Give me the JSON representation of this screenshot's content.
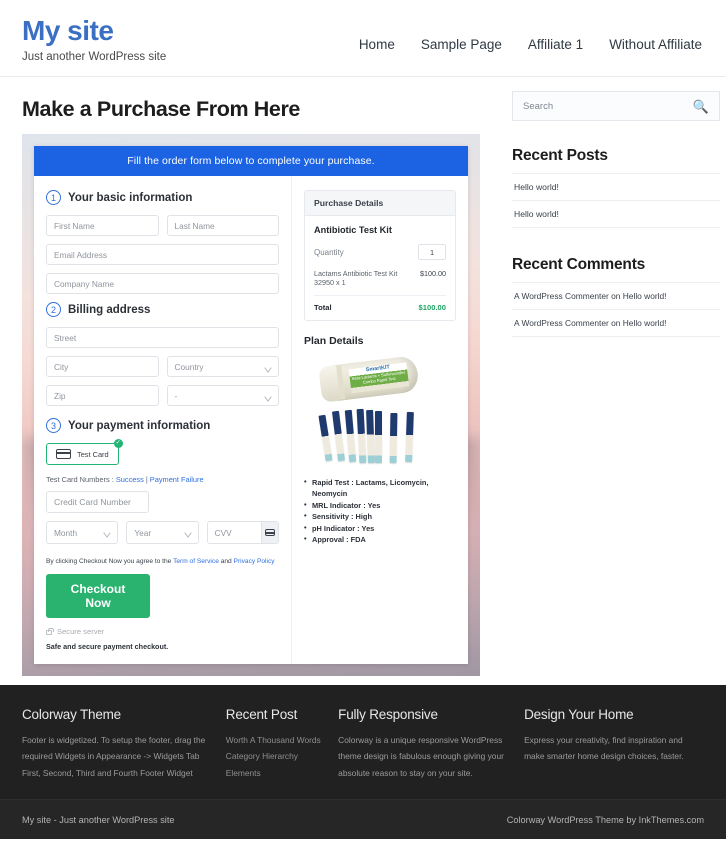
{
  "header": {
    "site_title": "My site",
    "tagline": "Just another WordPress site",
    "nav": [
      {
        "label": "Home"
      },
      {
        "label": "Sample Page"
      },
      {
        "label": "Affiliate 1"
      },
      {
        "label": "Without Affiliate"
      }
    ]
  },
  "main": {
    "page_title": "Make a Purchase From Here",
    "banner": "Fill the order form below to complete your purchase.",
    "steps": {
      "one_num": "1",
      "one_label": "Your basic information",
      "two_num": "2",
      "two_label": "Billing address",
      "three_num": "3",
      "three_label": "Your payment information"
    },
    "fields": {
      "first_name": "First Name",
      "last_name": "Last Name",
      "email": "Email Address",
      "company": "Company Name",
      "street": "Street",
      "city": "City",
      "country": "Country",
      "zip": "Zip",
      "state": "-",
      "credit_card": "Credit Card Number",
      "month": "Month",
      "year": "Year",
      "cvv": "CVV"
    },
    "payment": {
      "method_label": "Test Card",
      "method_tick": "✓",
      "test_cards_prefix": "Test Card Numbers : ",
      "test_card_success": "Success",
      "test_card_sep": " | ",
      "test_card_failure": "Payment Failure",
      "agree_prefix": "By clicking Checkout Now you agree to the ",
      "agree_tos": "Term of Service",
      "agree_and": " and ",
      "agree_privacy": "Privacy Policy",
      "checkout_button": "Checkout Now",
      "secure_server": "Secure server",
      "safe_note": "Safe and secure payment checkout."
    },
    "purchase": {
      "panel_title": "Purchase Details",
      "product_name": "Antibiotic Test Kit",
      "quantity_label": "Quantity",
      "quantity_value": "1",
      "line_item": "Lactams Antibiotic Test Kit 32950 x 1",
      "line_amount": "$100.00",
      "total_label": "Total",
      "total_amount": "$100.00",
      "plan_title": "Plan Details",
      "product_brand": "SmartKIT",
      "product_sub": "Beta-Lactams + Sulfonamides Combo Rapid Test",
      "bullets": [
        "Rapid Test : Lactams, Licomycin, Neomycin",
        "MRL Indicator : Yes",
        "Sensitivity : High",
        "pH Indicator : Yes",
        "Approval : FDA"
      ]
    }
  },
  "sidebar": {
    "search_placeholder": "Search",
    "search_icon": "🔍",
    "recent_posts_title": "Recent Posts",
    "recent_posts": [
      {
        "label": "Hello world!"
      },
      {
        "label": "Hello world!"
      }
    ],
    "recent_comments_title": "Recent Comments",
    "recent_comments": [
      {
        "label": "A WordPress Commenter on Hello world!"
      },
      {
        "label": "A WordPress Commenter on Hello world!"
      }
    ]
  },
  "footer": {
    "columns": [
      {
        "title": "Colorway Theme",
        "text": "Footer is widgetized. To setup the footer, drag the required Widgets in Appearance -> Widgets Tab First, Second, Third and Fourth Footer Widget"
      },
      {
        "title": "Recent Post",
        "items": [
          {
            "label": "Worth A Thousand Words"
          },
          {
            "label": "Category Hierarchy"
          },
          {
            "label": "Elements"
          }
        ]
      },
      {
        "title": "Fully Responsive",
        "text": "Colorway is a unique responsive WordPress theme design is fabulous enough giving your absolute reason to stay on your site."
      },
      {
        "title": "Design Your Home",
        "text": "Express your creativity, find inspiration and make smarter home design choices, faster."
      }
    ],
    "bottom_left": "My site - Just another WordPress site",
    "bottom_right": "Colorway WordPress Theme by InkThemes.com"
  },
  "colors": {
    "brand_blue": "#3b6fc4",
    "banner_blue": "#1b63e3",
    "accent_green": "#2ab36f",
    "total_green": "#1fa463",
    "link_blue": "#2f6fe0",
    "footer_dark": "#212121"
  }
}
